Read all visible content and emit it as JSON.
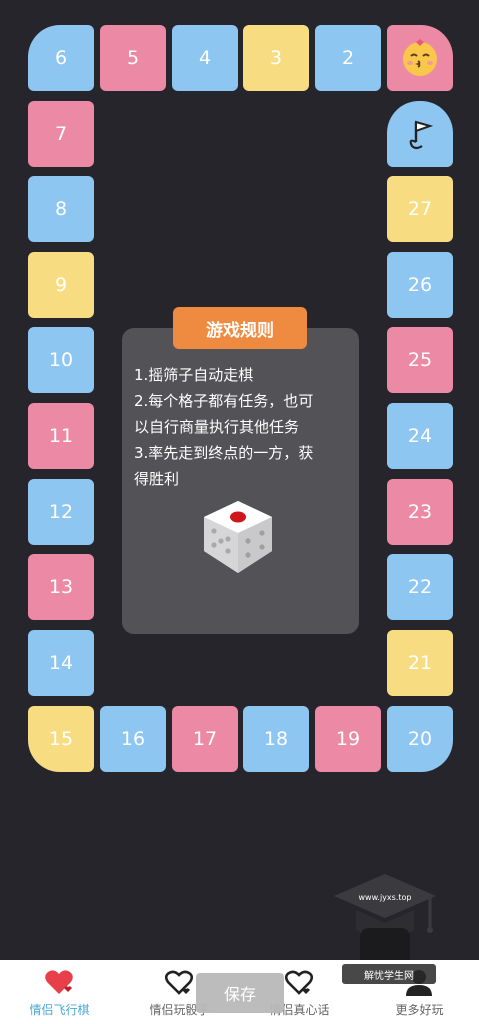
{
  "board": {
    "start_icon": "kiss-face-icon",
    "finish_icon": "finish-flag-icon",
    "cells": [
      {
        "label": "2",
        "color": "blue"
      },
      {
        "label": "3",
        "color": "yellow"
      },
      {
        "label": "4",
        "color": "blue"
      },
      {
        "label": "5",
        "color": "pink"
      },
      {
        "label": "6",
        "color": "blue"
      },
      {
        "label": "7",
        "color": "pink"
      },
      {
        "label": "8",
        "color": "blue"
      },
      {
        "label": "9",
        "color": "yellow"
      },
      {
        "label": "10",
        "color": "blue"
      },
      {
        "label": "11",
        "color": "pink"
      },
      {
        "label": "12",
        "color": "blue"
      },
      {
        "label": "13",
        "color": "pink"
      },
      {
        "label": "14",
        "color": "blue"
      },
      {
        "label": "15",
        "color": "yellow"
      },
      {
        "label": "16",
        "color": "blue"
      },
      {
        "label": "17",
        "color": "pink"
      },
      {
        "label": "18",
        "color": "blue"
      },
      {
        "label": "19",
        "color": "pink"
      },
      {
        "label": "20",
        "color": "blue"
      },
      {
        "label": "21",
        "color": "yellow"
      },
      {
        "label": "22",
        "color": "blue"
      },
      {
        "label": "23",
        "color": "pink"
      },
      {
        "label": "24",
        "color": "blue"
      },
      {
        "label": "25",
        "color": "pink"
      },
      {
        "label": "26",
        "color": "blue"
      },
      {
        "label": "27",
        "color": "yellow"
      }
    ]
  },
  "rules": {
    "title": "游戏规则",
    "lines": [
      "1.摇筛子自动走棋",
      "2.每个格子都有任务，也可",
      "以自行商量执行其他任务",
      "3.率先走到终点的一方，获",
      "得胜利"
    ],
    "dice_icon": "dice-icon"
  },
  "save_label": "保存",
  "watermark": {
    "url": "www.jyxs.top",
    "label": "解忧学生网"
  },
  "tabs": [
    {
      "label": "情侣飞行棋",
      "icon": "heart-icon",
      "active": true
    },
    {
      "label": "情侣玩骰子",
      "icon": "heart-outline-icon",
      "active": false
    },
    {
      "label": "情侣真心话",
      "icon": "heart-outline-icon",
      "active": false
    },
    {
      "label": "更多好玩",
      "icon": "user-icon",
      "active": false
    }
  ],
  "colors": {
    "blue": "#8ec6f2",
    "pink": "#ec8aa6",
    "yellow": "#f7dc82",
    "accent": "#ef8b41",
    "active_tab": "#4aa8d6"
  }
}
